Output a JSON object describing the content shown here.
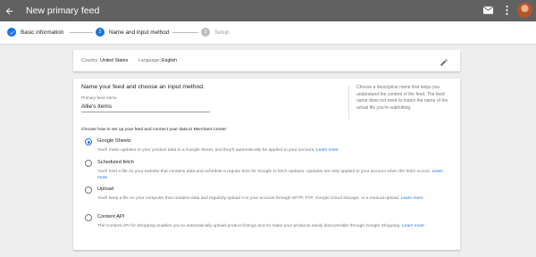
{
  "header": {
    "title": "New primary feed",
    "icons": [
      "back-arrow-icon",
      "mail-icon",
      "more-vert-icon",
      "avatar"
    ]
  },
  "stepper": {
    "steps": [
      {
        "number": "✓",
        "label": "Basic information",
        "state": "done"
      },
      {
        "number": "2",
        "label": "Name and input method",
        "state": "active"
      },
      {
        "number": "3",
        "label": "Setup",
        "state": "todo"
      }
    ]
  },
  "summary": {
    "country_label": "Country:",
    "country_value": "United States",
    "language_label": "Language:",
    "language_value": "English"
  },
  "form": {
    "heading": "Name your feed and choose an input method.",
    "field_label": "Primary feed name",
    "field_value": "Allie's Items",
    "help_text": "Choose a descriptive name that helps you understand the content of the feed. The feed name does not need to match the name of the actual file you're submitting.",
    "choose_label": "Choose how to set up your feed and connect your data to Merchant Center:",
    "options": [
      {
        "title": "Google Sheets",
        "desc": "You'll make updates to your product data in a Google Sheet, and they'll automatically be applied to your account.",
        "link": "Learn more",
        "selected": true
      },
      {
        "title": "Scheduled fetch",
        "desc": "You'll host a file on your website that contains data and schedule a regular time for Google to fetch updates. Updates are only applied to your account when the fetch occurs.",
        "link": "Learn more",
        "selected": false
      },
      {
        "title": "Upload",
        "desc": "You'll keep a file on your computer that contains data and regularly upload it to your account through SFTP, FTP, Google Cloud Storage, or a manual upload.",
        "link": "Learn more",
        "selected": false
      },
      {
        "title": "Content API",
        "desc": "The Content API for Shopping enables you to automatically upload product listings and so make your products easily discoverable through Google Shopping.",
        "link": "Learn more",
        "selected": false
      }
    ]
  },
  "colors": {
    "header_bg": "#616161",
    "accent": "#1a73e8",
    "page_bg": "#eeeeee"
  }
}
